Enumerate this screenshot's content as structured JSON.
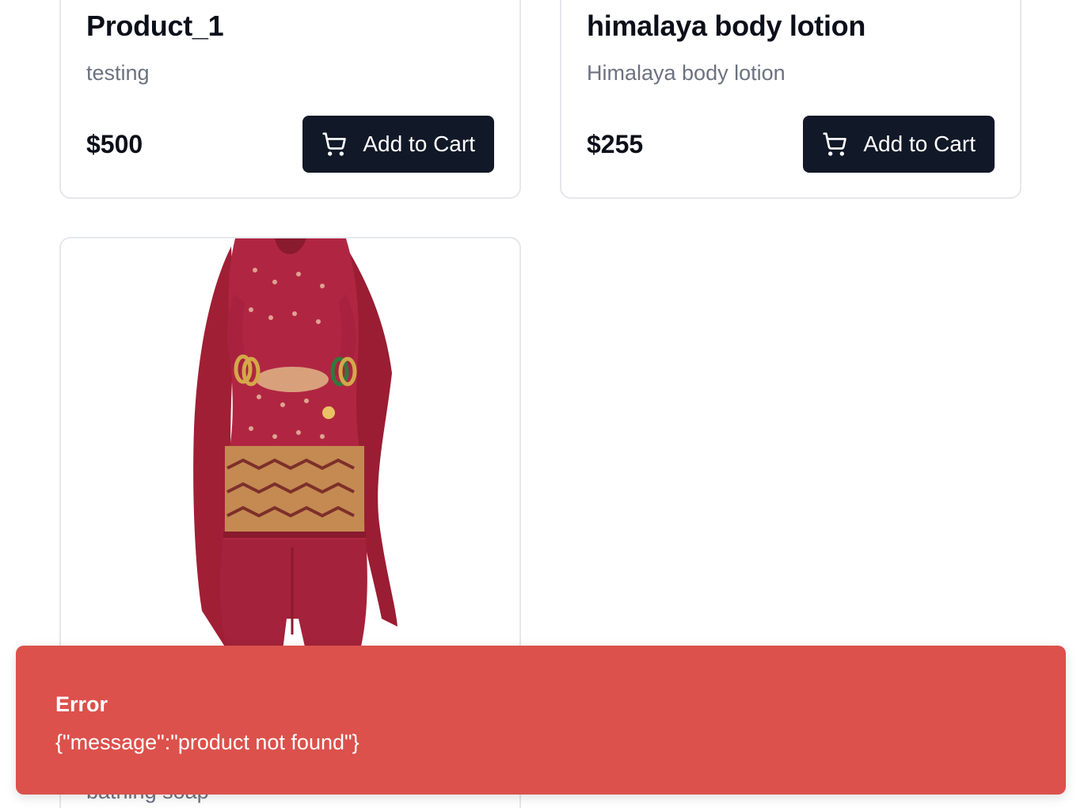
{
  "products": [
    {
      "title": "Product_1",
      "description": "testing",
      "price": "$500",
      "button_label": "Add to Cart"
    },
    {
      "title": "himalaya body lotion",
      "description": "Himalaya body lotion",
      "price": "$255",
      "button_label": "Add to Cart"
    },
    {
      "title": "",
      "description": "bathing soap",
      "image_alt": "red embroidered salwar suit"
    }
  ],
  "toast": {
    "title": "Error",
    "message": "{\"message\":\"product not found\"}"
  },
  "colors": {
    "button_bg": "#111827",
    "toast_bg": "#dc514c",
    "muted_text": "#6b7280",
    "card_border": "#e5e7eb",
    "dress_red": "#a8203a"
  },
  "icons": {
    "cart": "shopping-cart-icon"
  }
}
